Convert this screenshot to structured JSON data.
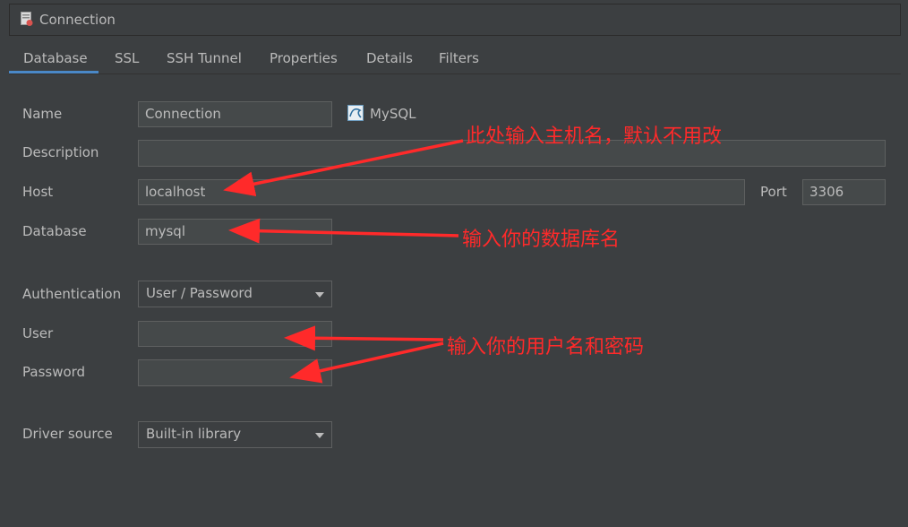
{
  "window": {
    "title": "Connection"
  },
  "tabs": [
    {
      "label": "Database"
    },
    {
      "label": "SSL"
    },
    {
      "label": "SSH Tunnel"
    },
    {
      "label": "Properties"
    },
    {
      "label": "Details"
    },
    {
      "label": "Filters"
    }
  ],
  "form": {
    "name_label": "Name",
    "name_value": "Connection",
    "db_type": "MySQL",
    "description_label": "Description",
    "description_value": "",
    "host_label": "Host",
    "host_value": "localhost",
    "port_label": "Port",
    "port_value": "3306",
    "database_label": "Database",
    "database_value": "mysql",
    "auth_label": "Authentication",
    "auth_value": "User / Password",
    "user_label": "User",
    "user_value": "",
    "password_label": "Password",
    "password_value": "",
    "driver_label": "Driver source",
    "driver_value": "Built-in library"
  },
  "annotations": {
    "host_note": "此处输入主机名，默认不用改",
    "database_note": "输入你的数据库名",
    "credentials_note": "输入你的用户名和密码"
  },
  "colors": {
    "background": "#3c3f41",
    "field_bg": "#45494a",
    "text": "#bbbbbb",
    "tab_accent": "#4a88c7",
    "annotation": "#ff2a2a"
  }
}
